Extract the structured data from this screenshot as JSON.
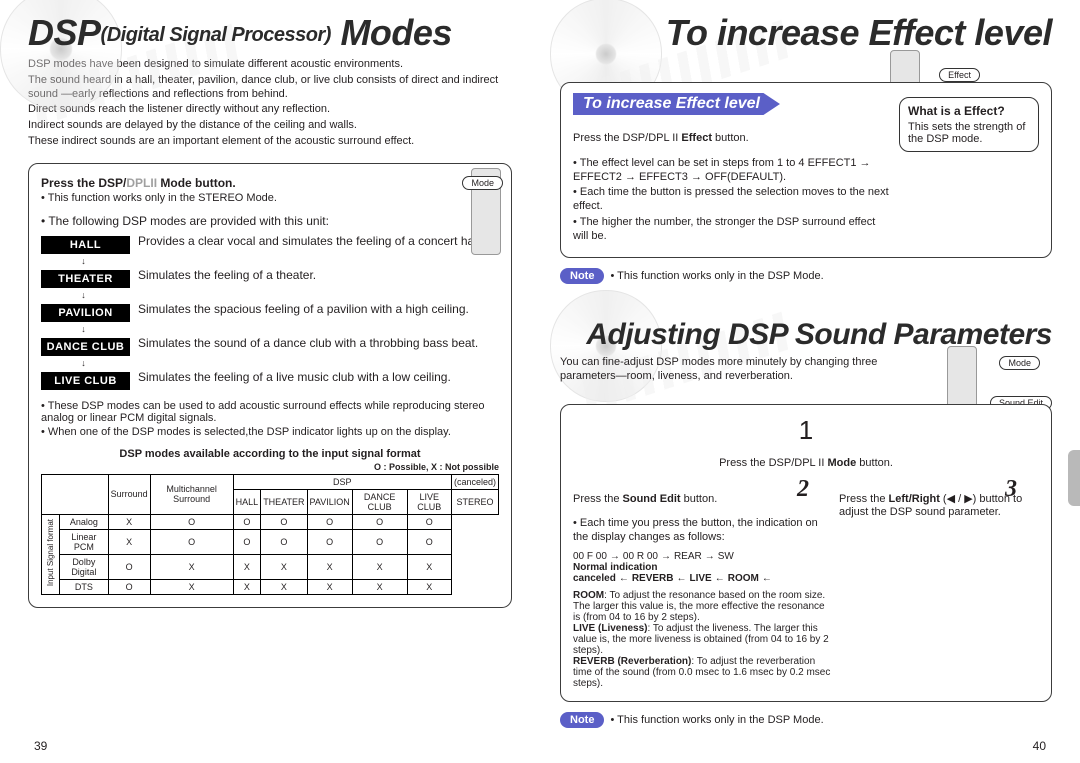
{
  "left": {
    "title_main": "DSP",
    "title_sub": "(Digital Signal Processor)",
    "title_tail": "Modes",
    "intro": [
      "DSP modes have been designed to simulate different acoustic environments.",
      "The sound heard in a hall, theater, pavilion, dance club, or live club consists of direct and indirect sound —early reflections and reflections from behind.",
      "Direct sounds reach the listener directly without any reflection.",
      "Indirect sounds are delayed by the distance of the ceiling and walls.",
      "These indirect sounds are an important element of the acoustic surround effect."
    ],
    "press_pre": "Press the ",
    "press_mid": "DSP/",
    "press_gray": "DPLII",
    "press_post": " Mode button.",
    "press_note": "This function works only in the STEREO Mode.",
    "provided": "The following DSP modes are provided with this unit:",
    "modes": [
      {
        "label": "HALL",
        "desc": "Provides a clear vocal and simulates the feeling of a concert hall."
      },
      {
        "label": "THEATER",
        "desc": "Simulates the feeling of a theater."
      },
      {
        "label": "PAVILION",
        "desc": "Simulates the spacious feeling of a pavilion with a high ceiling."
      },
      {
        "label": "DANCE CLUB",
        "desc": "Simulates the sound of a dance club with a throbbing bass beat."
      },
      {
        "label": "LIVE CLUB",
        "desc": "Simulates the feeling of a live music club with a low ceiling."
      }
    ],
    "footnotes": [
      "These DSP modes can be used to add acoustic surround effects while reproducing stereo analog or linear PCM digital signals.",
      "When one of the DSP modes is selected,the DSP indicator lights up on the display."
    ],
    "chart_title": "DSP modes available according to the input signal format",
    "chart_legend": "O : Possible, X : Not possible",
    "pill_mode": "Mode",
    "page_num": "39"
  },
  "chart_data": {
    "type": "table",
    "title": "DSP modes available according to the input signal format",
    "row_header_group": "Input Signal format",
    "col_groups": [
      {
        "name": "Surround",
        "span": 1
      },
      {
        "name": "Multichannel Surround",
        "span": 1
      },
      {
        "name": "DSP",
        "span": 5
      },
      {
        "name": "(canceled)",
        "span": 1
      }
    ],
    "columns": [
      "Surround",
      "Multichannel Surround",
      "HALL",
      "THEATER",
      "PAVILION",
      "DANCE CLUB",
      "LIVE CLUB",
      "STEREO"
    ],
    "rows": [
      {
        "name": "Analog",
        "values": [
          "X",
          "O",
          "O",
          "O",
          "O",
          "O",
          "O"
        ]
      },
      {
        "name": "Linear PCM",
        "values": [
          "X",
          "O",
          "O",
          "O",
          "O",
          "O",
          "O"
        ]
      },
      {
        "name": "Dolby Digital",
        "values": [
          "O",
          "X",
          "X",
          "X",
          "X",
          "X",
          "X"
        ]
      },
      {
        "name": "DTS",
        "values": [
          "O",
          "X",
          "X",
          "X",
          "X",
          "X",
          "X"
        ]
      }
    ]
  },
  "right": {
    "title1": "To increase Effect level",
    "banner1": "To increase Effect level",
    "effect_press_pre": "Press the DSP/DPL II ",
    "effect_press_strong": "Effect",
    "effect_press_post": " button.",
    "effect_bullets": [
      "The effect level can be set in steps from 1 to 4 EFFECT1 → EFFECT2 → EFFECT3 → OFF(DEFAULT).",
      "Each time the button is pressed the selection moves to the next effect.",
      "The higher the number, the stronger the DSP surround effect will be."
    ],
    "pill_effect": "Effect",
    "what_q": "What is a Effect?",
    "what_a": "This sets the strength of the DSP mode.",
    "note1": "This function works only in the DSP Mode.",
    "title2": "Adjusting DSP Sound Parameters",
    "adj_intro": "You can fine-adjust DSP modes more minutely by changing three parameters—room, liveness, and reverberation.",
    "pill_mode": "Mode",
    "pill_sound": "Sound Edit",
    "step1_num": "1",
    "step1_text_pre": "Press the DSP/DPL II ",
    "step1_text_strong": "Mode",
    "step1_text_post": " button.",
    "step2_num": "2",
    "step2_text_pre": "Press the ",
    "step2_text_strong": "Sound Edit",
    "step2_text_post": " button.",
    "step2_bullet": "Each time you press the button, the indication on the display changes as follows:",
    "step3_num": "3",
    "step3_text_pre": "Press the ",
    "step3_text_strong": "Left/Right",
    "step3_text_glyph": " (◀ / ▶) ",
    "step3_text_post": "button to adjust the DSP sound parameter.",
    "flow_top": [
      "00 F 00",
      "00 R 00",
      "REAR",
      "SW"
    ],
    "flow_bot": [
      "Normal indication canceled",
      "REVERB",
      "LIVE",
      "ROOM"
    ],
    "param_defs": [
      {
        "term": "ROOM",
        "body": ": To adjust the resonance based on the room size. The larger this value is, the more effective the resonance is (from 04 to 16 by 2 steps)."
      },
      {
        "term": "LIVE (Liveness)",
        "body": ": To adjust the liveness. The larger this value is, the more liveness is obtained (from 04 to 16 by 2 steps)."
      },
      {
        "term": "REVERB (Reverberation)",
        "body": ": To adjust the reverberation time of the sound (from 0.0 msec to 1.6 msec by 0.2 msec steps)."
      }
    ],
    "note2": "This function works only in the DSP Mode.",
    "note_label": "Note",
    "page_num": "40"
  }
}
